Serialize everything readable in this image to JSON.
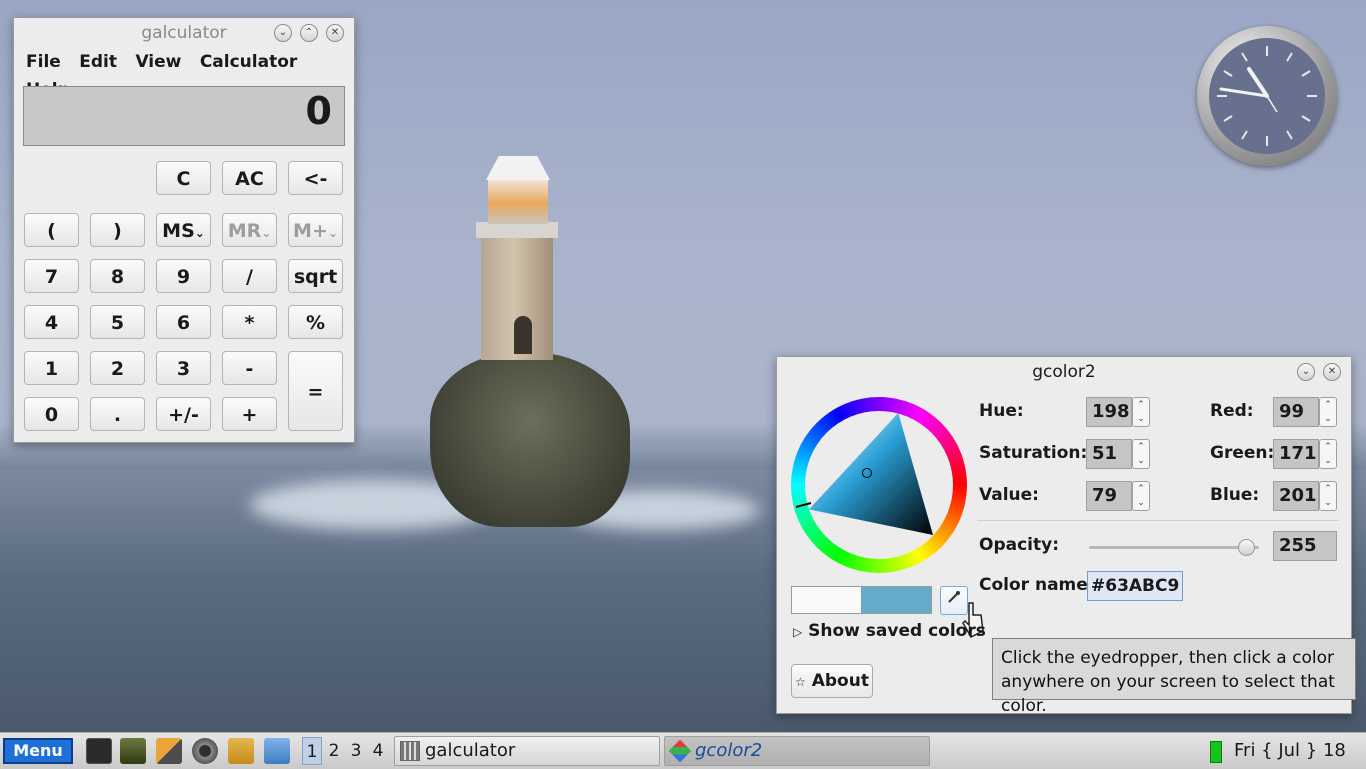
{
  "galculator": {
    "title": "galculator",
    "menu": [
      "File",
      "Edit",
      "View",
      "Calculator",
      "Help"
    ],
    "display_value": "0",
    "buttons": {
      "c": "C",
      "ac": "AC",
      "backspace": "<-",
      "lparen": "(",
      "rparen": ")",
      "ms": "MS",
      "mr": "MR",
      "mplus": "M+",
      "seven": "7",
      "eight": "8",
      "nine": "9",
      "divide": "/",
      "sqrt": "sqrt",
      "four": "4",
      "five": "5",
      "six": "6",
      "multiply": "*",
      "percent": "%",
      "one": "1",
      "two": "2",
      "three": "3",
      "minus": "-",
      "equals": "=",
      "zero": "0",
      "dot": ".",
      "plusminus": "+/-",
      "plus": "+"
    }
  },
  "gcolor2": {
    "title": "gcolor2",
    "labels": {
      "hue": "Hue:",
      "saturation": "Saturation:",
      "value": "Value:",
      "red": "Red:",
      "green": "Green:",
      "blue": "Blue:",
      "opacity": "Opacity:",
      "color_name": "Color name:"
    },
    "values": {
      "hue": "198",
      "saturation": "51",
      "value": "79",
      "red": "99",
      "green": "171",
      "blue": "201",
      "opacity": "255",
      "color_name": "#63ABC9"
    },
    "current_color": "#63abc9",
    "show_saved_colors": "Show saved colors",
    "about_label": "About",
    "tooltip": "Click the eyedropper, then click a color anywhere on your screen to select that color."
  },
  "taskbar": {
    "menu_label": "Menu",
    "desktops": [
      "1",
      "2",
      "3",
      "4"
    ],
    "tasks": [
      {
        "label": "galculator"
      },
      {
        "label": "gcolor2"
      }
    ],
    "clock": "Fri { Jul } 18"
  }
}
